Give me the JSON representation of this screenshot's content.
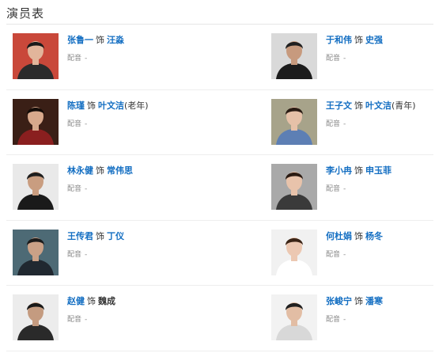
{
  "section": {
    "title": "演员表"
  },
  "as_word": "饰",
  "dub_label": "配音",
  "cast": [
    {
      "actor": "张鲁一",
      "role": "汪淼",
      "role_suffix": "",
      "role_linked": true,
      "dub": "-",
      "photo": {
        "bg": "#c9483a",
        "skin": "#e2b59b",
        "hair": "#1a1a1a",
        "shirt": "#2b2b2b"
      }
    },
    {
      "actor": "于和伟",
      "role": "史强",
      "role_suffix": "",
      "role_linked": true,
      "dub": "-",
      "photo": {
        "bg": "#d9d9d9",
        "skin": "#c79a7e",
        "hair": "#202020",
        "shirt": "#1c1c1c"
      }
    },
    {
      "actor": "陈瑾",
      "role": "叶文洁",
      "role_suffix": "(老年)",
      "role_linked": true,
      "dub": "-",
      "photo": {
        "bg": "#3a1f16",
        "skin": "#d8a98c",
        "hair": "#140c08",
        "shirt": "#8a1f1f"
      }
    },
    {
      "actor": "王子文",
      "role": "叶文洁",
      "role_suffix": "(青年)",
      "role_linked": true,
      "dub": "-",
      "photo": {
        "bg": "#a7a38a",
        "skin": "#e6c1a8",
        "hair": "#2a1c14",
        "shirt": "#5d7fb4"
      }
    },
    {
      "actor": "林永健",
      "role": "常伟思",
      "role_suffix": "",
      "role_linked": true,
      "dub": "-",
      "photo": {
        "bg": "#e9e9e9",
        "skin": "#c99d80",
        "hair": "#1e1e1e",
        "shirt": "#1a1a1a"
      }
    },
    {
      "actor": "李小冉",
      "role": "申玉菲",
      "role_suffix": "",
      "role_linked": true,
      "dub": "-",
      "photo": {
        "bg": "#a9a9a9",
        "skin": "#e8c3ab",
        "hair": "#2a1a12",
        "shirt": "#3a3a3a"
      }
    },
    {
      "actor": "王传君",
      "role": "丁仪",
      "role_suffix": "",
      "role_linked": true,
      "dub": "-",
      "photo": {
        "bg": "#4d6a75",
        "skin": "#caa187",
        "hair": "#1b1b1b",
        "shirt": "#202830"
      }
    },
    {
      "actor": "何杜娟",
      "role": "杨冬",
      "role_suffix": "",
      "role_linked": true,
      "dub": "-",
      "photo": {
        "bg": "#f1f1f1",
        "skin": "#ecc8b2",
        "hair": "#3a2416",
        "shirt": "#ffffff"
      }
    },
    {
      "actor": "赵健",
      "role": "魏成",
      "role_suffix": "",
      "role_linked": false,
      "dub": "-",
      "photo": {
        "bg": "#ececec",
        "skin": "#c49b80",
        "hair": "#181818",
        "shirt": "#2a2a2a"
      }
    },
    {
      "actor": "张峻宁",
      "role": "潘寒",
      "role_suffix": "",
      "role_linked": true,
      "dub": "-",
      "photo": {
        "bg": "#f2f2f2",
        "skin": "#e2bda4",
        "hair": "#1f1f1f",
        "shirt": "#d8d8d8"
      }
    }
  ]
}
